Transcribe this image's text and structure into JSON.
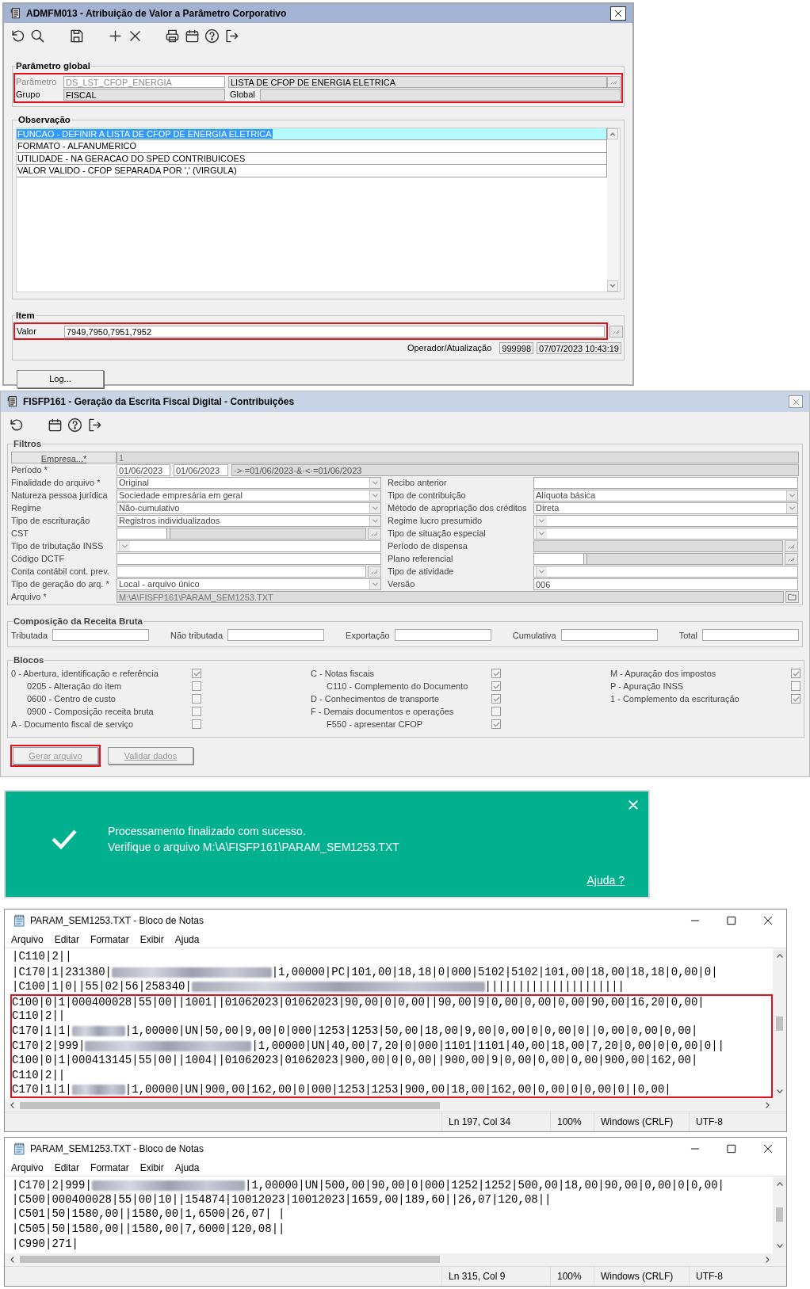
{
  "param_window": {
    "title": "ADMFM013 - Atribuição de Valor a Parâmetro Corporativo",
    "parametro_global": {
      "title": "Parâmetro global",
      "highlighted": true,
      "parametro": {
        "label": "Parâmetro",
        "value": "DS_LST_CFOP_ENERGIA",
        "description": "LISTA DE CFOP DE ENERGIA ELETRICA",
        "disabled": true
      },
      "grupo": {
        "label": "Grupo",
        "value": "FISCAL"
      },
      "global": {
        "label": "Global"
      }
    },
    "observacao": {
      "title": "Observação",
      "rows": [
        {
          "text": "FUNCAO - DEFINIR A LISTA DE CFOP DE ENERGIA ELETRICA",
          "selected": true
        },
        {
          "text": "FORMATO - ALFANUMERICO",
          "selected": false
        },
        {
          "text": "UTILIDADE - NA GERACAO DO SPED CONTRIBUICOES",
          "selected": false
        },
        {
          "text": "VALOR VALIDO - CFOP SEPARADA POR ',' (VIRGULA)",
          "selected": false
        }
      ]
    },
    "item": {
      "title": "Item",
      "valor": {
        "label": "Valor",
        "value": "7949,7950,7951,7952",
        "highlighted": true
      },
      "operador": {
        "label": "Operador/Atualização",
        "code": "999998",
        "timestamp": "07/07/2023 10:43:19"
      }
    },
    "log_button": "Log..."
  },
  "fiscal_window": {
    "title": "FISFP161 - Geração da Escrita Fiscal Digital - Contribuições",
    "filtros": {
      "title": "Filtros",
      "empresa": {
        "label": "Empresa...*",
        "value": "1",
        "disabled": true
      },
      "periodo": {
        "label": "Período *",
        "from": "01/06/2023",
        "to": "01/06/2023",
        "expression": "·>·=01/06/2023·&·<·=01/06/2023"
      },
      "left_fields": [
        {
          "label": "Finalidade do arquivo *",
          "value": "Original",
          "kind": "dropdown"
        },
        {
          "label": "Natureza pessoa jurídica",
          "value": "Sociedade empresária em geral",
          "kind": "dropdown"
        },
        {
          "label": "Regime",
          "value": "Não-cumulativo",
          "kind": "dropdown"
        },
        {
          "label": "Tipo de escrituração",
          "value": "Registros individualizados",
          "kind": "dropdown"
        },
        {
          "label": "CST",
          "kind": "range"
        },
        {
          "label": "Tipo de tributação INSS",
          "kind": "dropdown"
        },
        {
          "label": "Código DCTF",
          "kind": "text"
        },
        {
          "label": "Conta contábil cont. prev.",
          "kind": "lookup"
        },
        {
          "label": "Tipo de geração do arq. *",
          "value": "Local - arquivo único",
          "kind": "dropdown"
        }
      ],
      "right_fields": [
        {
          "label": "Recibo anterior",
          "kind": "text"
        },
        {
          "label": "Tipo de contribuição",
          "value": "Alíquota básica",
          "kind": "dropdown"
        },
        {
          "label": "Método de apropriação dos créditos",
          "value": "Direta",
          "kind": "dropdown"
        },
        {
          "label": "Regime lucro presumido",
          "kind": "dropdown"
        },
        {
          "label": "Tipo de situação especial",
          "kind": "dropdown"
        },
        {
          "label": "Período de dispensa",
          "kind": "lookup_disabled"
        },
        {
          "label": "Plano referencial",
          "kind": "range"
        },
        {
          "label": "Tipo de atividade",
          "kind": "dropdown"
        },
        {
          "label": "Versão",
          "value": "006",
          "kind": "text"
        }
      ],
      "arquivo": {
        "label": "Arquivo *",
        "value": "M:\\A\\FISFP161\\PARAM_SEM1253.TXT",
        "disabled": true
      }
    },
    "composicao": {
      "title": "Composição da Receita Bruta",
      "fields": [
        {
          "label": "Tributada"
        },
        {
          "label": "Não tributada"
        },
        {
          "label": "Exportação"
        },
        {
          "label": "Cumulativa"
        },
        {
          "label": "Total"
        }
      ]
    },
    "blocos": {
      "title": "Blocos",
      "columns": [
        [
          {
            "label": "0 - Abertura, identificação e referência",
            "checked": true,
            "children": [
              {
                "label": "0205 - Alteração do item",
                "checked": false
              },
              {
                "label": "0600 - Centro de custo",
                "checked": false
              },
              {
                "label": "0900 - Composição receita bruta",
                "checked": false
              }
            ]
          },
          {
            "label": "A - Documento fiscal de serviço",
            "checked": false
          }
        ],
        [
          {
            "label": "C - Notas fiscais",
            "checked": true,
            "children": [
              {
                "label": "C110 - Complemento do Documento",
                "checked": true
              }
            ]
          },
          {
            "label": "D - Conhecimentos de transporte",
            "checked": true
          },
          {
            "label": "F - Demais documentos e operações",
            "checked": false,
            "children": [
              {
                "label": "F550 - apresentar CFOP",
                "checked": true
              }
            ]
          }
        ],
        [
          {
            "label": "M - Apuração dos impostos",
            "checked": true
          },
          {
            "label": "P - Apuração INSS",
            "checked": false
          },
          {
            "label": "1 - Complemento da escrituração",
            "checked": true
          }
        ]
      ]
    },
    "buttons": [
      {
        "label": "Gerar arquivo",
        "disabled": true,
        "highlighted": true
      },
      {
        "label": "Validar dados",
        "disabled": true,
        "highlighted": false
      }
    ]
  },
  "notification": {
    "lines": [
      "Processamento finalizado com sucesso.",
      "Verifique o arquivo M:\\A\\FISFP161\\PARAM_SEM1253.TXT"
    ],
    "help_link": "Ajuda ?"
  },
  "notepads": [
    {
      "title": "PARAM_SEM1253.TXT - Bloco de Notas",
      "menu": [
        "Arquivo",
        "Editar",
        "Formatar",
        "Exibir",
        "Ajuda"
      ],
      "lines": [
        {
          "highlighted": false,
          "segments": [
            {
              "kind": "text",
              "text": "|C110|2||"
            }
          ]
        },
        {
          "highlighted": false,
          "segments": [
            {
              "kind": "text",
              "text": "|C170|1|231380|"
            },
            {
              "kind": "redacted"
            },
            {
              "kind": "text",
              "text": "|1,00000|PC|101,00|18,18|0|000|5102|5102|101,00|18,00|18,18|0,00|0|"
            }
          ]
        },
        {
          "highlighted": false,
          "segments": [
            {
              "kind": "text",
              "text": "|C100|1|0||55|02|56|258340|"
            },
            {
              "kind": "redacted"
            },
            {
              "kind": "text",
              "text": "|||||||||||||||||||||"
            }
          ]
        },
        {
          "highlighted": true,
          "segments": [
            {
              "kind": "text",
              "text": "C100|0|1|000400028|55|00||1001||01062023|01062023|90,00|0|0,00||90,00|9|0,00|0,00|0,00|90,00|16,20|0,00|"
            }
          ]
        },
        {
          "highlighted": true,
          "segments": [
            {
              "kind": "text",
              "text": "C110|2||"
            }
          ]
        },
        {
          "highlighted": true,
          "segments": [
            {
              "kind": "text",
              "text": "C170|1|1|"
            },
            {
              "kind": "redacted"
            },
            {
              "kind": "text",
              "text": "|1,00000|UN|50,00|9,00|0|000|1253|1253|50,00|18,00|9,00|0,00|0|0,00|0||0,00|0,00|0,00|"
            }
          ]
        },
        {
          "highlighted": true,
          "segments": [
            {
              "kind": "text",
              "text": "C170|2|999|"
            },
            {
              "kind": "redacted"
            },
            {
              "kind": "text",
              "text": "|1,00000|UN|40,00|7,20|0|000|1101|1101|40,00|18,00|7,20|0,00|0|0,00|0||"
            }
          ]
        },
        {
          "highlighted": true,
          "segments": [
            {
              "kind": "text",
              "text": "C100|0|1|000413145|55|00||1004||01062023|01062023|900,00|0|0,00||900,00|9|0,00|0,00|0,00|900,00|162,00|"
            }
          ]
        },
        {
          "highlighted": true,
          "segments": [
            {
              "kind": "text",
              "text": "C110|2||"
            }
          ]
        },
        {
          "highlighted": true,
          "segments": [
            {
              "kind": "text",
              "text": "C170|1|1|"
            },
            {
              "kind": "redacted"
            },
            {
              "kind": "text",
              "text": "|1,00000|UN|900,00|162,00|0|000|1253|1253|900,00|18,00|162,00|0,00|0|0,00|0||0,00|"
            }
          ]
        }
      ],
      "status": {
        "position": "Ln 197, Col 34",
        "zoom": "100%",
        "line_ending": "Windows (CRLF)",
        "encoding": "UTF-8"
      }
    },
    {
      "title": "PARAM_SEM1253.TXT - Bloco de Notas",
      "menu": [
        "Arquivo",
        "Editar",
        "Formatar",
        "Exibir",
        "Ajuda"
      ],
      "lines": [
        {
          "highlighted": false,
          "segments": [
            {
              "kind": "text",
              "text": "|C170|2|999|"
            },
            {
              "kind": "redacted"
            },
            {
              "kind": "text",
              "text": "|1,00000|UN|500,00|90,00|0|000|1252|1252|500,00|18,00|90,00|0,00|0|0,00|"
            }
          ]
        },
        {
          "highlighted": false,
          "segments": [
            {
              "kind": "text",
              "text": "|C500|000400028|55|00|10||154874|10012023|10012023|1659,00|189,60||26,07|120,08||"
            }
          ]
        },
        {
          "highlighted": false,
          "segments": [
            {
              "kind": "text",
              "text": "|C501|50|1580,00||1580,00|1,6500|26,07| |"
            }
          ]
        },
        {
          "highlighted": false,
          "segments": [
            {
              "kind": "text",
              "text": "|C505|50|1580,00||1580,00|7,6000|120,08||"
            }
          ]
        },
        {
          "highlighted": false,
          "segments": [
            {
              "kind": "text",
              "text": "|C990|271|"
            }
          ]
        }
      ],
      "status": {
        "position": "Ln 315, Col 9",
        "zoom": "100%",
        "line_ending": "Windows (CRLF)",
        "encoding": "UTF-8"
      }
    }
  ]
}
